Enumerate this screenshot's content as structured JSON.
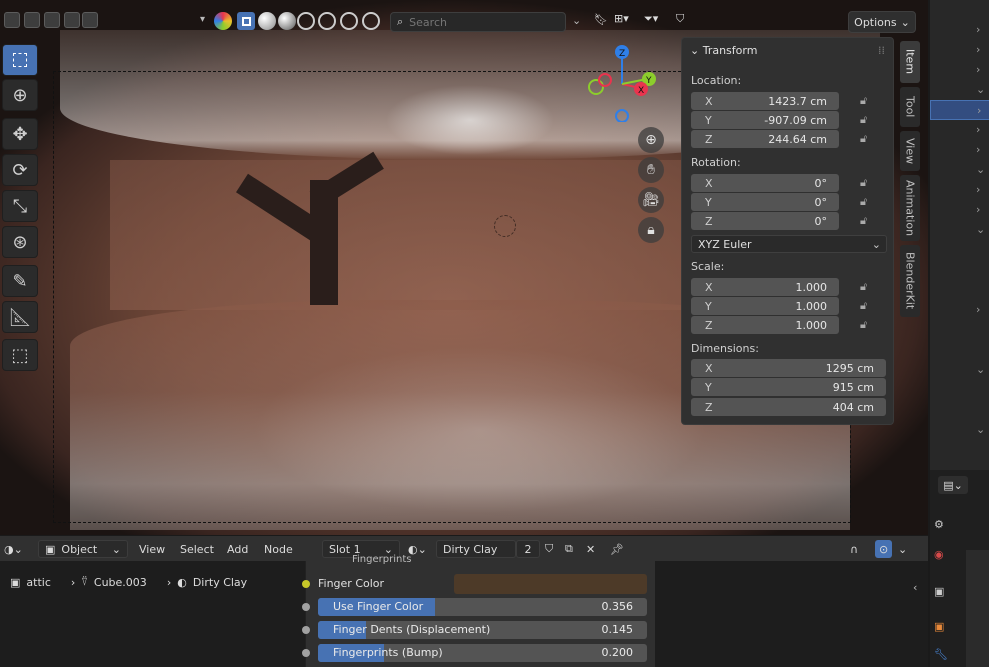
{
  "header": {
    "search_placeholder": "Search",
    "options_label": "Options"
  },
  "npanel": {
    "title": "Transform",
    "location_label": "Location:",
    "location": [
      {
        "axis": "X",
        "value": "1423.7 cm"
      },
      {
        "axis": "Y",
        "value": "-907.09 cm"
      },
      {
        "axis": "Z",
        "value": "244.64 cm"
      }
    ],
    "rotation_label": "Rotation:",
    "rotation": [
      {
        "axis": "X",
        "value": "0°"
      },
      {
        "axis": "Y",
        "value": "0°"
      },
      {
        "axis": "Z",
        "value": "0°"
      }
    ],
    "rotation_mode": "XYZ Euler",
    "scale_label": "Scale:",
    "scale": [
      {
        "axis": "X",
        "value": "1.000"
      },
      {
        "axis": "Y",
        "value": "1.000"
      },
      {
        "axis": "Z",
        "value": "1.000"
      }
    ],
    "dimensions_label": "Dimensions:",
    "dimensions": [
      {
        "axis": "X",
        "value": "1295 cm"
      },
      {
        "axis": "Y",
        "value": "915 cm"
      },
      {
        "axis": "Z",
        "value": "404 cm"
      }
    ]
  },
  "vtabs": [
    "Item",
    "Tool",
    "View",
    "Animation",
    "BlenderKit"
  ],
  "gizmo": {
    "x": "X",
    "y": "Y",
    "z": "Z"
  },
  "node_editor": {
    "mode": "Object",
    "menus": [
      "View",
      "Select",
      "Add",
      "Node"
    ],
    "slot": "Slot 1",
    "material": "Dirty Clay",
    "user_count": "2",
    "breadcrumb": [
      "attic",
      "Cube.003",
      "Dirty Clay"
    ]
  },
  "node": {
    "panel_header": "Fingerprints",
    "finger_color_label": "Finger Color",
    "finger_color": "#4d3a28",
    "sliders": [
      {
        "label": "Use Finger Color",
        "value": "0.356",
        "fraction": 0.356
      },
      {
        "label": "Finger Dents (Displacement)",
        "value": "0.145",
        "fraction": 0.145
      },
      {
        "label": "Fingerprints (Bump)",
        "value": "0.200",
        "fraction": 0.2
      }
    ]
  },
  "colors": {
    "accent": "#4772b3",
    "x_axis": "#e8344e",
    "y_axis": "#8ccd2c",
    "z_axis": "#2f7fe8"
  }
}
